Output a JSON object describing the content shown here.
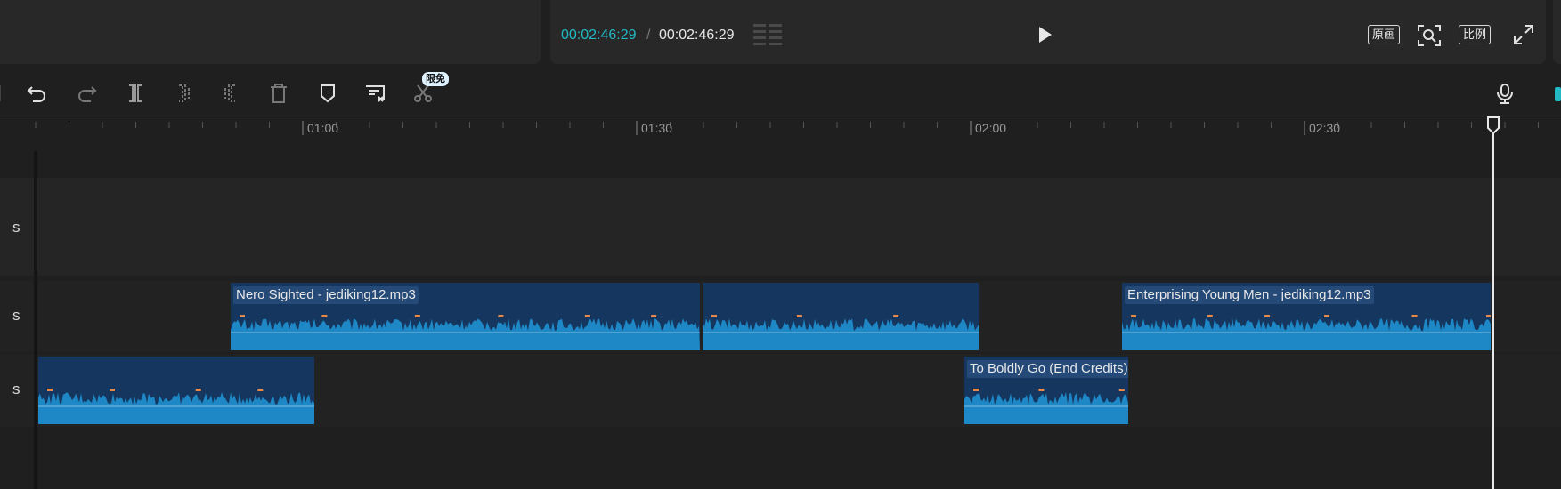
{
  "player": {
    "current_time": "00:02:46:29",
    "separator": "/",
    "total_time": "00:02:46:29",
    "original_label": "原画",
    "ratio_label": "比例"
  },
  "toolbar": {
    "badge": "限免",
    "icons": [
      "undo-icon",
      "redo-icon",
      "split-icon",
      "trim-left-icon",
      "trim-right-icon",
      "delete-icon",
      "marker-icon",
      "auto-caption-icon",
      "scissors-icon",
      "microphone-icon"
    ]
  },
  "ruler": {
    "labels": [
      "01:00",
      "01:30",
      "02:00",
      "02:30"
    ]
  },
  "tracks": [
    {
      "label": "s"
    },
    {
      "label": "s"
    },
    {
      "label": "s"
    }
  ],
  "clips": {
    "nero": "Nero Sighted - jediking12.mp3",
    "enterprising": "Enterprising Young Men - jediking12.mp3",
    "boldly": "To Boldly Go (End Credits)"
  },
  "colors": {
    "accent": "#22b8c4",
    "clip_bg": "#15365e",
    "waveform": "#1e88c7",
    "peak": "#e8894a"
  }
}
